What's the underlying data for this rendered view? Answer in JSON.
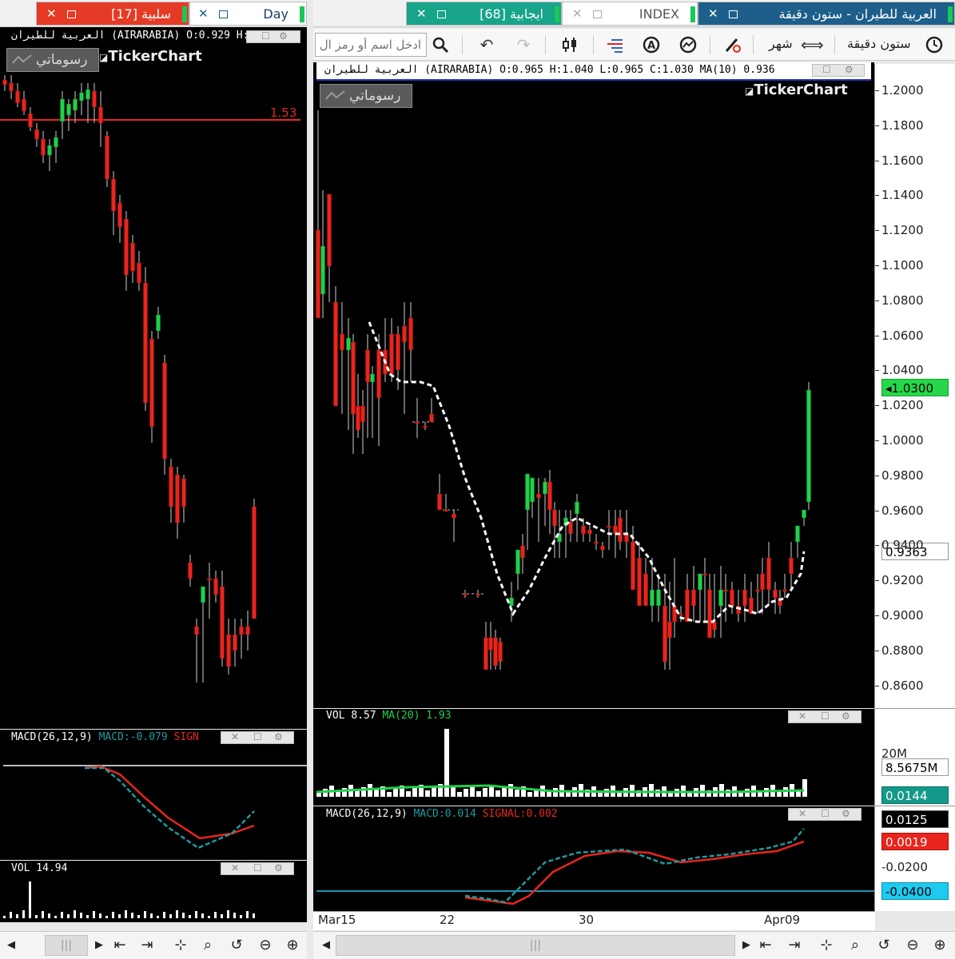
{
  "left": {
    "tabs": [
      {
        "label": "سلبية [17]",
        "bg": "#e53b26"
      },
      {
        "label": "Day",
        "bg": "#1d5f8a"
      }
    ],
    "header": "العربية للطيران (AIRARABIA) O:0.929 H:1.",
    "brand": "TickerChart",
    "drawings_label": "رسوماتي",
    "hline_value": "1.53",
    "macd_label": "MACD(26,12,9)",
    "macd_value": "MACD:-0.079",
    "signal_partial": "SIGN",
    "vol_label": "VOL 14.94"
  },
  "right": {
    "tabs": [
      {
        "label": "ايجابية [68]",
        "bg": "#17a48a"
      },
      {
        "label": "INDEX",
        "bg": "#ffffff"
      },
      {
        "label": "العربية للطيران - ستون دقيقة",
        "bg": "#1d5f8a"
      }
    ],
    "toolbar": {
      "search_placeholder": "ادخل اسم أو رمز ال",
      "period": "شهر",
      "interval": "ستون دقيقة"
    },
    "header": {
      "name": "العربية للطيران",
      "symbol": "(AIRARABIA)",
      "ohlc": "O:0.965 H:1.040 L:0.965 C:1.030",
      "ma": "MA(10)",
      "ma_value": "0.936"
    },
    "brand": "TickerChart",
    "drawings_label": "رسوماتي",
    "vol": {
      "label": "VOL",
      "value": "8.57",
      "ma_label": "MA(20)",
      "ma_value": "1.93"
    },
    "macd": {
      "label": "MACD(26,12,9)",
      "macd": "MACD:0.014",
      "signal": "SIGNAL:0.002"
    },
    "price_axis": [
      "1.2000",
      "1.1800",
      "1.1600",
      "1.1400",
      "1.1200",
      "1.1000",
      "1.0800",
      "1.0600",
      "1.0400",
      "1.0200",
      "1.0000",
      "0.9800",
      "0.9600",
      "0.9400",
      "0.9200",
      "0.9000",
      "0.8800",
      "0.8600"
    ],
    "last_price": "1.0300",
    "ma_price": "0.9363",
    "vol_axis": {
      "tick": "20M",
      "value": "8.5675M",
      "ma_value": "0.0144"
    },
    "macd_axis": {
      "macd": "0.0125",
      "signal": "0.0019",
      "tick1": "-0.0200",
      "hline": "-0.0400"
    },
    "x_axis": [
      "Mar15",
      "22",
      "30",
      "Apr09"
    ]
  },
  "colors": {
    "up": "#1fd14a",
    "down": "#e8251c",
    "ma": "#ffffff",
    "macd": "#1f9aa0",
    "signal": "#e8251c",
    "hline_left": "#e8251c",
    "hline_right": "#2ec0e8",
    "last_badge": "#27d74a"
  }
}
